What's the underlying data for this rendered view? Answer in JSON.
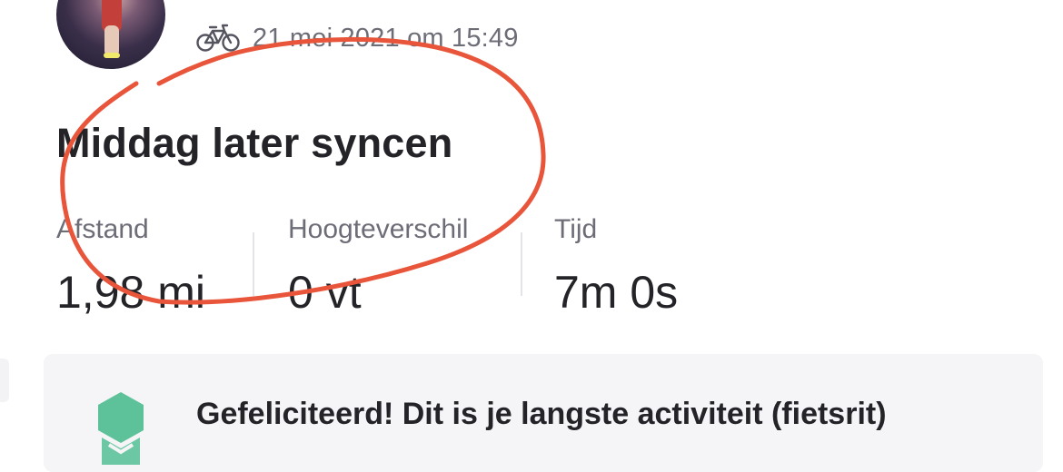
{
  "activity": {
    "date": "21 mei 2021 om 15:49",
    "title": "Middag later syncen",
    "type_icon": "bike-icon",
    "avatar_icon": "avatar-photo"
  },
  "stats": [
    {
      "label": "Afstand",
      "value": "1,98 mi"
    },
    {
      "label": "Hoogteverschil",
      "value": "0 vt"
    },
    {
      "label": "Tijd",
      "value": "7m 0s"
    }
  ],
  "achievement": {
    "text": "Gefeliciteerd! Dit is je langste activiteit (fietsrit)",
    "icon": "achievement-badge-icon",
    "icon_color": "#5dc29a"
  },
  "colors": {
    "annotation": "#e8553a",
    "text_primary": "#242428",
    "text_secondary": "#6d6d78",
    "card_background": "#f5f5f7"
  }
}
